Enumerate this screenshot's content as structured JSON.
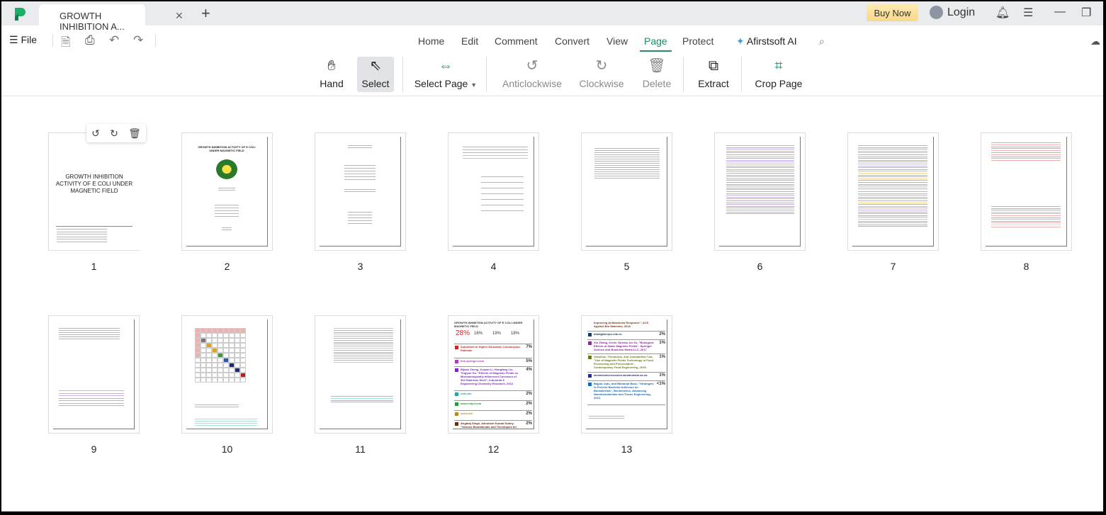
{
  "window": {
    "tab_title": "GROWTH INHIBITION A...",
    "buy_now": "Buy Now",
    "login": "Login"
  },
  "menu": {
    "file": "File",
    "tabs": [
      "Home",
      "Edit",
      "Comment",
      "Convert",
      "View",
      "Page",
      "Protect",
      "Afirstsoft AI"
    ],
    "active_tab": "Page"
  },
  "toolbar": {
    "hand": "Hand",
    "select": "Select",
    "select_page": "Select Page",
    "anticlockwise": "Anticlockwise",
    "clockwise": "Clockwise",
    "delete": "Delete",
    "extract": "Extract",
    "crop_page": "Crop Page"
  },
  "colors": {
    "accent": "#1f8a5e",
    "buy_now": "#f9d98a"
  },
  "pages": {
    "numbers": [
      "1",
      "2",
      "3",
      "4",
      "5",
      "6",
      "7",
      "8",
      "9",
      "10",
      "11",
      "12",
      "13"
    ],
    "p1_title": "GROWTH INHIBITION ACTIVITY OF E COLI UNDER MAGNETIC FIELD",
    "p2_title": "GROWTH INHIBITION ACTIVITY OF E COLI UNDER MAGNETIC FIELD",
    "p12": {
      "title": "GROWTH INHIBITION ACTIVITY OF E COLI UNDER MAGNETIC FIELD",
      "scores": [
        "28%",
        "16%",
        "19%",
        "18%"
      ],
      "sources": [
        {
          "n": "1",
          "text": "Submitted to Higher Education Commission Pakistan",
          "pct": "7%",
          "color": "#d0232b"
        },
        {
          "n": "2",
          "text": "link.springer.com",
          "pct": "5%",
          "color": "#b03cc0"
        },
        {
          "n": "3",
          "text": "Bijuan Zheng, Kejuan Li, Hongfang Liu, Tingyue Gu. \"Effects of Magnetic Fields on Microbiologically Influenced Corrosion of 304 Stainless Steel\", Industrial & Engineering Chemistry Research, 2013",
          "pct": "4%",
          "color": "#7a2cb8"
        },
        {
          "n": "4",
          "text": "umt.edu",
          "pct": "2%",
          "color": "#2aa0a0"
        },
        {
          "n": "5",
          "text": "www.mdpi.com",
          "pct": "2%",
          "color": "#2a9a3a"
        },
        {
          "n": "6",
          "text": "dorsi.net",
          "pct": "2%",
          "color": "#b08a2a"
        },
        {
          "n": "7",
          "text": "Angaraj Singh, Ashutosh Kumar Dubey. \"Various Biomaterials and Techniques for",
          "pct": "2%",
          "color": "#6a2a1a"
        }
      ]
    },
    "p13": {
      "header": "Improving Antibacterial Response\", ACS Applied Bio Materials, 2018",
      "sources": [
        {
          "n": "8",
          "text": "bibdigital.epn.edu.ec",
          "pct": "2%",
          "color": "#1a3a6a"
        },
        {
          "n": "9",
          "text": "Xin Zhang, Kevin Yarema, An Xu. \"Biological Effects of Static Magnetic Fields\", Springer Science and Business Media LLC, 2017",
          "pct": "1%",
          "color": "#8a2a9a"
        },
        {
          "n": "10",
          "text": "Vassilios, Theodoros, and Constantina Tzia. \"Use of Magnetic Fields Technology in Food Processing and Preservation\", Contemporary Food Engineering, 2015.",
          "pct": "1%",
          "color": "#6a7a1a"
        },
        {
          "n": "11",
          "text": "westminsterresearch.westminster.ac.uk",
          "pct": "1%",
          "color": "#2a2a8a"
        },
        {
          "n": "12",
          "text": "Bajpai, Indu, and Bikramjit Basu. \"Strategies to Prevent Bacterial Adhesion on Biomaterials\", Biomimetics, Advancing Nanobiomaterials and Tissue Engineering, 2013.",
          "pct": "<1%",
          "color": "#1a6ab0"
        }
      ]
    }
  }
}
